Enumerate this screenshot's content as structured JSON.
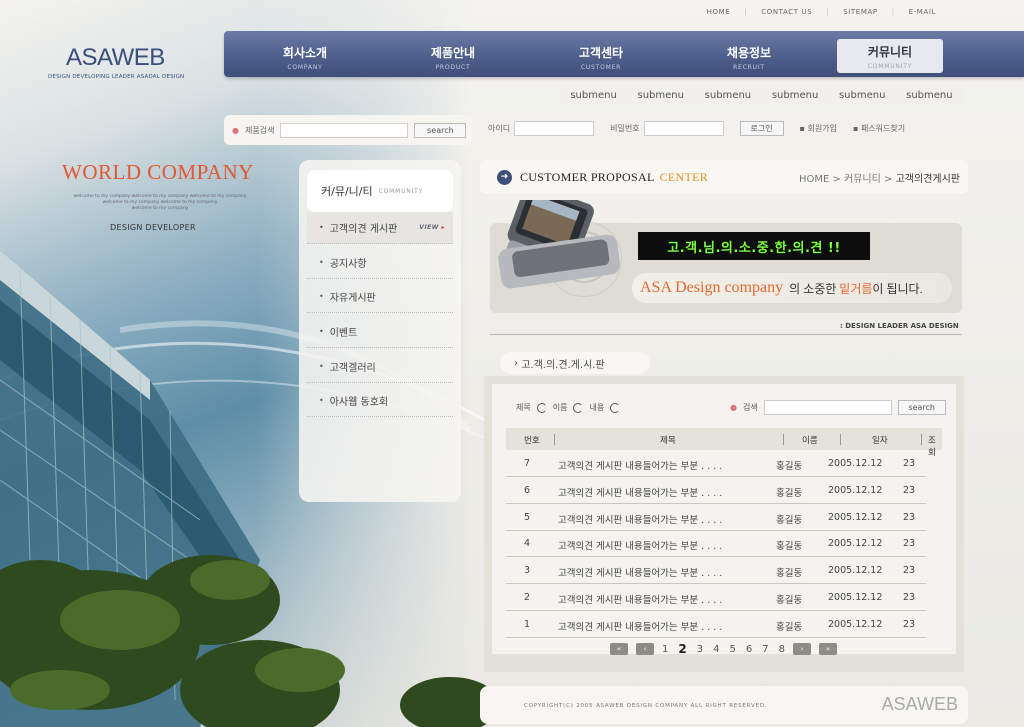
{
  "top_links": [
    "HOME",
    "CONTACT US",
    "SITEMAP",
    "E-MAIL"
  ],
  "logo": {
    "name": "ASAWEB",
    "tagline": "DESIGN DEVELOPING LEADER ASADAL DESIGN"
  },
  "main_nav": [
    {
      "ko": "회사소개",
      "en": "COMPANY"
    },
    {
      "ko": "제품안내",
      "en": "PRODUCT"
    },
    {
      "ko": "고객센타",
      "en": "CUSTOMER"
    },
    {
      "ko": "채용정보",
      "en": "RECRUIT"
    },
    {
      "ko": "커뮤니티",
      "en": "COMMUNITY"
    }
  ],
  "sub_nav": [
    "submenu",
    "submenu",
    "submenu",
    "submenu",
    "submenu",
    "submenu"
  ],
  "product_search": {
    "label": "제품검색",
    "button": "search"
  },
  "login": {
    "id_label": "아이디",
    "pw_label": "비밀번호",
    "button": "로그인",
    "join": "회원가입",
    "find_pw": "패스워드찾기"
  },
  "brand": {
    "title": "WORLD COMPANY",
    "welcome": [
      "welcome to my company  welcome to my company  welcome to my company",
      "welcome to my company  welcome to my company",
      "welcome to my company"
    ],
    "subtitle": "DESIGN DEVELOPER"
  },
  "side_menu": {
    "title_ko": "커/뮤/니/티",
    "title_en": "COMMUNITY",
    "view_label": "VIEW",
    "items": [
      "고객의견 게시판",
      "공지사항",
      "자유게시판",
      "이벤트",
      "고객겔러리",
      "아사웹 동호회"
    ]
  },
  "content": {
    "title": "CUSTOMER PROPOSAL",
    "title_accent": "CENTER",
    "breadcrumb": [
      "HOME",
      "커뮤니티",
      "고객의견게시판"
    ],
    "banner_sign": "고.객.님.의.소.중.한.의.견 !!",
    "slogan_accent": "ASA Design company",
    "slogan_mid": "의 소중한",
    "slogan_highlight": "밑거름",
    "slogan_end": "이 됩니다.",
    "design_credit": ": DESIGN  LEADER ASA DESIGN",
    "section_title": "고.객.의.견.게.시.판"
  },
  "board": {
    "filters": [
      "제목",
      "이름",
      "내용"
    ],
    "search_label": "검색",
    "search_button": "search",
    "headers": [
      "번호",
      "제목",
      "이름",
      "일자",
      "조회"
    ],
    "rows": [
      {
        "no": "7",
        "title": "고객의견 게시판 내용들어가는 부분 . . . .",
        "name": "홍길동",
        "date": "2005.12.12",
        "views": "23"
      },
      {
        "no": "6",
        "title": "고객의견 게시판 내용들어가는 부분 . . . .",
        "name": "홍길동",
        "date": "2005.12.12",
        "views": "23"
      },
      {
        "no": "5",
        "title": "고객의견 게시판 내용들어가는 부분 . . . .",
        "name": "홍길동",
        "date": "2005.12.12",
        "views": "23"
      },
      {
        "no": "4",
        "title": "고객의견 게시판 내용들어가는 부분 . . . .",
        "name": "홍길동",
        "date": "2005.12.12",
        "views": "23"
      },
      {
        "no": "3",
        "title": "고객의견 게시판 내용들어가는 부분 . . . .",
        "name": "홍길동",
        "date": "2005.12.12",
        "views": "23"
      },
      {
        "no": "2",
        "title": "고객의견 게시판 내용들어가는 부분 . . . .",
        "name": "홍길동",
        "date": "2005.12.12",
        "views": "23"
      },
      {
        "no": "1",
        "title": "고객의견 게시판 내용들어가는 부분 . . . .",
        "name": "홍길동",
        "date": "2005.12.12",
        "views": "23"
      }
    ]
  },
  "pager": {
    "pages": [
      "1",
      "2",
      "3",
      "4",
      "5",
      "6",
      "7",
      "8"
    ],
    "current": "2"
  },
  "footer": {
    "copyright": "COPYRIGHT(C) 2005 ASAWEB DESIGN COMPANY ALL RIGHT RESERVED.",
    "logo": "ASAWEB"
  },
  "colors": {
    "nav_blue": "#4f5f8b",
    "accent_orange": "#e4572e",
    "sign_green": "#7bff3d"
  }
}
